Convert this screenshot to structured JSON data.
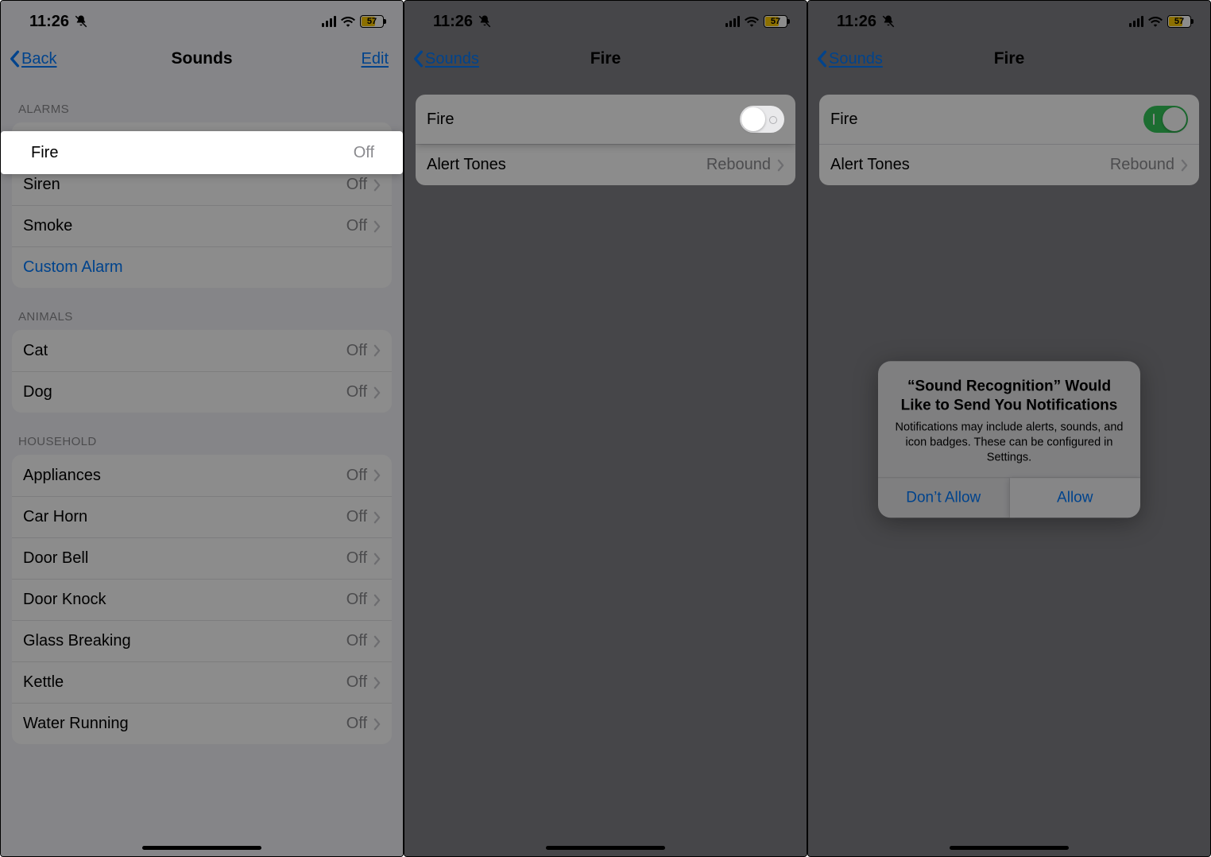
{
  "status": {
    "time": "11:26",
    "battery": "57"
  },
  "screen1": {
    "back": "Back",
    "title": "Sounds",
    "edit": "Edit",
    "sections": {
      "alarms": {
        "header": "ALARMS",
        "items": {
          "fire": {
            "label": "Fire",
            "value": "Off"
          },
          "siren": {
            "label": "Siren",
            "value": "Off"
          },
          "smoke": {
            "label": "Smoke",
            "value": "Off"
          },
          "custom": {
            "label": "Custom Alarm"
          }
        }
      },
      "animals": {
        "header": "ANIMALS",
        "items": {
          "cat": {
            "label": "Cat",
            "value": "Off"
          },
          "dog": {
            "label": "Dog",
            "value": "Off"
          }
        }
      },
      "household": {
        "header": "HOUSEHOLD",
        "items": {
          "appliances": {
            "label": "Appliances",
            "value": "Off"
          },
          "carhorn": {
            "label": "Car Horn",
            "value": "Off"
          },
          "doorbell": {
            "label": "Door Bell",
            "value": "Off"
          },
          "doorknock": {
            "label": "Door Knock",
            "value": "Off"
          },
          "glass": {
            "label": "Glass Breaking",
            "value": "Off"
          },
          "kettle": {
            "label": "Kettle",
            "value": "Off"
          },
          "water": {
            "label": "Water Running",
            "value": "Off"
          }
        }
      }
    }
  },
  "screen2": {
    "back": "Sounds",
    "title": "Fire",
    "rows": {
      "fire": {
        "label": "Fire"
      },
      "tones": {
        "label": "Alert Tones",
        "value": "Rebound"
      }
    }
  },
  "screen3": {
    "back": "Sounds",
    "title": "Fire",
    "rows": {
      "fire": {
        "label": "Fire"
      },
      "tones": {
        "label": "Alert Tones",
        "value": "Rebound"
      }
    },
    "alert": {
      "title": "“Sound Recognition” Would Like to Send You Notifications",
      "message": "Notifications may include alerts, sounds, and icon badges. These can be configured in Settings.",
      "deny": "Don’t Allow",
      "allow": "Allow"
    }
  }
}
